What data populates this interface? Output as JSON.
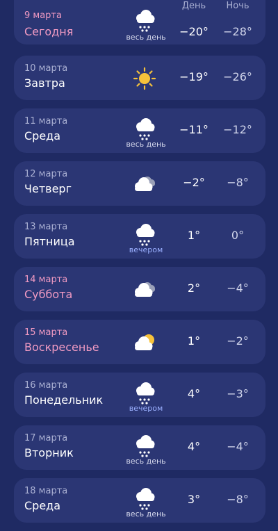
{
  "headers": {
    "day": "День",
    "night": "Ночь"
  },
  "colors": {
    "background": "#1f2a63",
    "card": "#2b3674",
    "weekend_text": "#f29bc3"
  },
  "days": [
    {
      "date": "9 марта",
      "name": "Сегодня",
      "icon": "snow-cloud-icon",
      "note": "весь день",
      "day_temp": "−20°",
      "night_temp": "−28°",
      "highlight": true
    },
    {
      "date": "10 марта",
      "name": "Завтра",
      "icon": "sun-icon",
      "note": "",
      "day_temp": "−19°",
      "night_temp": "−26°",
      "highlight": false
    },
    {
      "date": "11 марта",
      "name": "Среда",
      "icon": "snow-cloud-icon",
      "note": "весь день",
      "day_temp": "−11°",
      "night_temp": "−12°",
      "highlight": false
    },
    {
      "date": "12 марта",
      "name": "Четверг",
      "icon": "cloudy-icon",
      "note": "",
      "day_temp": "−2°",
      "night_temp": "−8°",
      "highlight": false
    },
    {
      "date": "13 марта",
      "name": "Пятница",
      "icon": "snow-cloud-icon",
      "note": "вечером",
      "day_temp": "1°",
      "night_temp": "0°",
      "highlight": false
    },
    {
      "date": "14 марта",
      "name": "Суббота",
      "icon": "cloudy-icon",
      "note": "",
      "day_temp": "2°",
      "night_temp": "−4°",
      "highlight": true
    },
    {
      "date": "15 марта",
      "name": "Воскресенье",
      "icon": "partly-cloudy-icon",
      "note": "",
      "day_temp": "1°",
      "night_temp": "−2°",
      "highlight": true
    },
    {
      "date": "16 марта",
      "name": "Понедельник",
      "icon": "snow-cloud-icon",
      "note": "вечером",
      "day_temp": "4°",
      "night_temp": "−3°",
      "highlight": false
    },
    {
      "date": "17 марта",
      "name": "Вторник",
      "icon": "snow-cloud-icon",
      "note": "весь день",
      "day_temp": "4°",
      "night_temp": "−4°",
      "highlight": false
    },
    {
      "date": "18 марта",
      "name": "Среда",
      "icon": "snow-cloud-icon",
      "note": "весь день",
      "day_temp": "3°",
      "night_temp": "−8°",
      "highlight": false
    }
  ]
}
